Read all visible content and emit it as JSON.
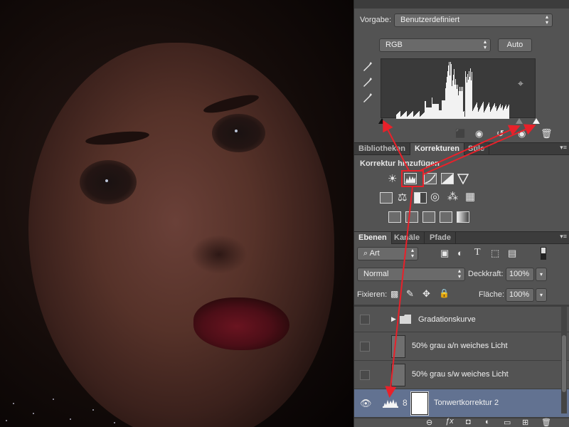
{
  "properties": {
    "preset_label": "Vorgabe:",
    "preset_value": "Benutzerdefiniert",
    "channel_value": "RGB",
    "auto_button": "Auto"
  },
  "adjustments_tabs": [
    {
      "label": "Bibliotheken"
    },
    {
      "label": "Korrekturen"
    },
    {
      "label": "Stile"
    }
  ],
  "adjustments": {
    "heading": "Korrektur hinzufügen"
  },
  "layers_tabs": [
    {
      "label": "Ebenen"
    },
    {
      "label": "Kanäle"
    },
    {
      "label": "Pfade"
    }
  ],
  "layers_panel": {
    "filter_value": "Art",
    "blend_mode": "Normal",
    "opacity_label": "Deckkraft:",
    "opacity_value": "100%",
    "lock_label": "Fixieren:",
    "fill_label": "Fläche:",
    "fill_value": "100%"
  },
  "layers": [
    {
      "name": "Gradationskurve",
      "type": "group"
    },
    {
      "name": "50% grau a/n weiches Licht",
      "type": "pixel"
    },
    {
      "name": "50% grau s/w weiches Licht",
      "type": "pixel"
    },
    {
      "name": "Tonwertkorrektur 2",
      "type": "adjustment",
      "selected": true
    }
  ],
  "colors": {
    "panel_bg": "#535353",
    "selected_layer": "#627291",
    "annotation_red": "#e8212a"
  }
}
